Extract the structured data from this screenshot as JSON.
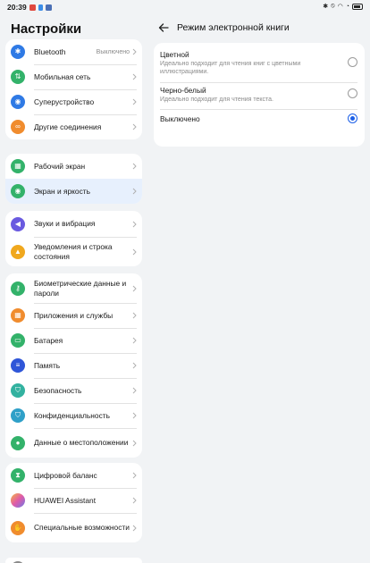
{
  "status_bar": {
    "time": "20:39"
  },
  "left_pane": {
    "title": "Настройки",
    "groups": [
      [
        {
          "label": "Bluetooth",
          "value": "Выключено",
          "icon": "bluetooth-icon",
          "color": "#2f7ae5"
        },
        {
          "label": "Мобильная сеть",
          "icon": "mobile-network-icon",
          "color": "#33b26a"
        },
        {
          "label": "Суперустройство",
          "icon": "super-device-icon",
          "color": "#2f7ae5"
        },
        {
          "label": "Другие соединения",
          "icon": "link-icon",
          "color": "#f08c2e"
        }
      ],
      [
        {
          "label": "Рабочий экран",
          "icon": "home-screen-icon",
          "color": "#33b26a"
        },
        {
          "label": "Экран и яркость",
          "icon": "brightness-icon",
          "color": "#33b26a",
          "active": true
        }
      ],
      [
        {
          "label": "Звуки и вибрация",
          "icon": "sound-icon",
          "color": "#6a5ae0"
        },
        {
          "label": "Уведомления и строка состояния",
          "icon": "bell-icon",
          "color": "#f0a81e"
        }
      ],
      [
        {
          "label": "Биометрические данные и пароли",
          "icon": "key-icon",
          "color": "#33b26a"
        },
        {
          "label": "Приложения и службы",
          "icon": "apps-icon",
          "color": "#f08c2e"
        },
        {
          "label": "Батарея",
          "icon": "battery-icon",
          "color": "#33b26a"
        },
        {
          "label": "Память",
          "icon": "storage-icon",
          "color": "#2f56d8"
        },
        {
          "label": "Безопасность",
          "icon": "shield-icon",
          "color": "#33b2a0"
        },
        {
          "label": "Конфиденциальность",
          "icon": "privacy-icon",
          "color": "#2fa0c8"
        },
        {
          "label": "Данные о местоположении",
          "icon": "location-icon",
          "color": "#33b26a"
        }
      ],
      [
        {
          "label": "Цифровой баланс",
          "icon": "hourglass-icon",
          "color": "#33b26a"
        },
        {
          "label": "HUAWEI Assistant",
          "icon": "assistant-icon",
          "color": "#c76ae0"
        },
        {
          "label": "Специальные возможности",
          "icon": "accessibility-icon",
          "color": "#f08c2e"
        }
      ]
    ]
  },
  "right_pane": {
    "title": "Режим электронной книги",
    "options": [
      {
        "title": "Цветной",
        "desc": "Идеально подходит для чтения книг с цветными иллюстрациями.",
        "selected": false
      },
      {
        "title": "Черно-белый",
        "desc": "Идеально подходит для чтения текста.",
        "selected": false
      },
      {
        "title": "Выключено",
        "desc": "",
        "selected": true
      }
    ]
  }
}
